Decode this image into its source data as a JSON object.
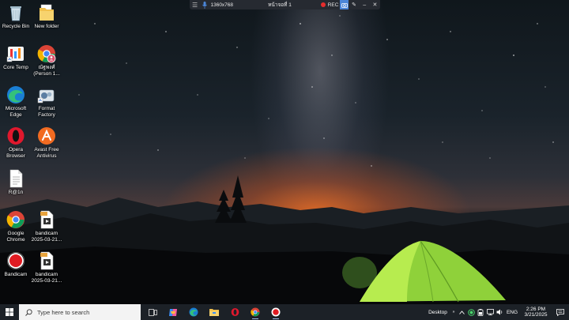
{
  "desktop": {
    "icons": [
      {
        "name": "recycle-bin-icon",
        "label": "Recycle Bin"
      },
      {
        "name": "new-folder-icon",
        "label": "New folder"
      },
      {
        "name": "core-temp-icon",
        "label": "Core Temp"
      },
      {
        "name": "chrome-profile-icon",
        "label": "ณัฐพงศ์ (Person 1..."
      },
      {
        "name": "microsoft-edge-icon",
        "label": "Microsoft Edge"
      },
      {
        "name": "format-factory-icon",
        "label": "Format Factory"
      },
      {
        "name": "opera-browser-icon",
        "label": "Opera Browser"
      },
      {
        "name": "avast-antivirus-icon",
        "label": "Avast Free Antivirus"
      },
      {
        "name": "text-file-icon",
        "label": "R@1n"
      },
      {
        "name": "google-chrome-icon",
        "label": "Google Chrome"
      },
      {
        "name": "bandicam-video-icon",
        "label": "bandicam 2025-03-21..."
      },
      {
        "name": "bandicam-icon",
        "label": "Bandicam"
      },
      {
        "name": "bandicam-video-2-icon",
        "label": "bandicam 2025-03-21..."
      }
    ]
  },
  "recorder": {
    "resolution": "1360x768",
    "title": "หน้าจอที่ 1",
    "status": "REC",
    "rec_color": "#e52d2d",
    "accent": "#4b86d8"
  },
  "taskbar": {
    "search_placeholder": "Type here to search",
    "apps": [
      "task-view",
      "copilot",
      "edge",
      "file-explorer",
      "opera",
      "chrome",
      "bandicam"
    ],
    "tray": {
      "desktop_label": "Desktop",
      "language": "ENG",
      "time": "2:26 PM",
      "date": "3/21/2025"
    },
    "background": "#1c2127"
  }
}
